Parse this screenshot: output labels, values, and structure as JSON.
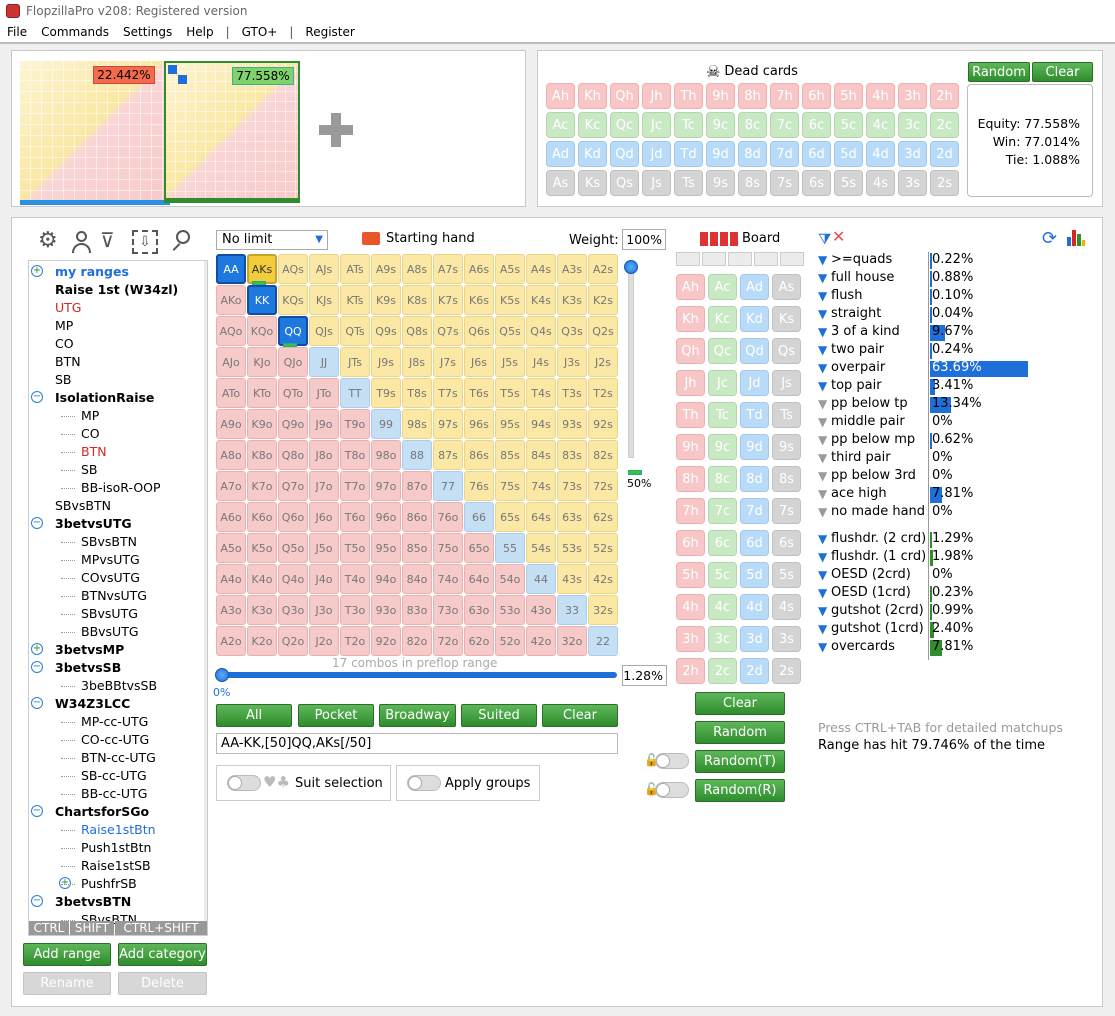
{
  "window": {
    "title": "FlopzillaPro v208: Registered version"
  },
  "menu": [
    "File",
    "Commands",
    "Settings",
    "Help",
    "GTO+",
    "Register"
  ],
  "ranges": {
    "left_pct": "22.442%",
    "right_pct": "77.558%"
  },
  "dead_cards": {
    "title": "Dead cards",
    "random": "Random",
    "clear": "Clear",
    "rows": [
      [
        "Ah",
        "Kh",
        "Qh",
        "Jh",
        "Th",
        "9h",
        "8h",
        "7h",
        "6h",
        "5h",
        "4h",
        "3h",
        "2h"
      ],
      [
        "Ac",
        "Kc",
        "Qc",
        "Jc",
        "Tc",
        "9c",
        "8c",
        "7c",
        "6c",
        "5c",
        "4c",
        "3c",
        "2c"
      ],
      [
        "Ad",
        "Kd",
        "Qd",
        "Jd",
        "Td",
        "9d",
        "8d",
        "7d",
        "6d",
        "5d",
        "4d",
        "3d",
        "2d"
      ],
      [
        "As",
        "Ks",
        "Qs",
        "Js",
        "Ts",
        "9s",
        "8s",
        "7s",
        "6s",
        "5s",
        "4s",
        "3s",
        "2s"
      ]
    ]
  },
  "equity": {
    "equity": "Equity: 77.558%",
    "win": "Win: 77.014%",
    "tie": "Tie: 1.088%"
  },
  "tree": [
    {
      "label": "my ranges",
      "level": 1,
      "style": "blue-bold",
      "toggle": "plus"
    },
    {
      "label": "Raise 1st (W34zl)",
      "level": 1,
      "style": "bold"
    },
    {
      "label": "UTG",
      "level": 1,
      "style": "red"
    },
    {
      "label": "MP",
      "level": 1
    },
    {
      "label": "CO",
      "level": 1
    },
    {
      "label": "BTN",
      "level": 1
    },
    {
      "label": "SB",
      "level": 1
    },
    {
      "label": "IsolationRaise",
      "level": 1,
      "style": "bold",
      "toggle": "minus"
    },
    {
      "label": "MP",
      "level": 2
    },
    {
      "label": "CO",
      "level": 2
    },
    {
      "label": "BTN",
      "level": 2,
      "style": "red"
    },
    {
      "label": "SB",
      "level": 2
    },
    {
      "label": "BB-isoR-OOP",
      "level": 2
    },
    {
      "label": "SBvsBTN",
      "level": 1
    },
    {
      "label": "3betvsUTG",
      "level": 1,
      "style": "bold",
      "toggle": "minus"
    },
    {
      "label": "SBvsBTN",
      "level": 2
    },
    {
      "label": "MPvsUTG",
      "level": 2
    },
    {
      "label": "COvsUTG",
      "level": 2
    },
    {
      "label": "BTNvsUTG",
      "level": 2
    },
    {
      "label": "SBvsUTG",
      "level": 2
    },
    {
      "label": "BBvsUTG",
      "level": 2
    },
    {
      "label": "3betvsMP",
      "level": 1,
      "style": "bold",
      "toggle": "plus"
    },
    {
      "label": "3betvsSB",
      "level": 1,
      "style": "bold",
      "toggle": "minus"
    },
    {
      "label": "3beBBtvsSB",
      "level": 2
    },
    {
      "label": "W34Z3LCC",
      "level": 1,
      "style": "bold",
      "toggle": "minus"
    },
    {
      "label": "MP-cc-UTG",
      "level": 2
    },
    {
      "label": "CO-cc-UTG",
      "level": 2
    },
    {
      "label": "BTN-cc-UTG",
      "level": 2
    },
    {
      "label": "SB-cc-UTG",
      "level": 2
    },
    {
      "label": "BB-cc-UTG",
      "level": 2
    },
    {
      "label": "ChartsforSGo",
      "level": 1,
      "style": "bold",
      "toggle": "minus"
    },
    {
      "label": "Raise1stBtn",
      "level": 2,
      "style": "blue"
    },
    {
      "label": "Push1stBtn",
      "level": 2
    },
    {
      "label": "Raise1stSB",
      "level": 2
    },
    {
      "label": "PushfrSB",
      "level": 2,
      "toggle": "plus"
    },
    {
      "label": "3betvsBTN",
      "level": 1,
      "style": "bold",
      "toggle": "minus"
    },
    {
      "label": "SBvsBTN",
      "level": 2
    }
  ],
  "keys": [
    "CTRL",
    "SHIFT",
    "CTRL+SHIFT"
  ],
  "tree_buttons": {
    "add_range": "Add range",
    "add_category": "Add category",
    "rename": "Rename",
    "delete": "Delete"
  },
  "matrix": {
    "limit": "No limit",
    "starting_hand": "Starting hand",
    "weight_label": "Weight:",
    "weight": "100%",
    "slider_pct": "50%",
    "combos": "17 combos in preflop range",
    "range_pct": "1.28%",
    "zero": "0%",
    "range_text": "AA-KK,[50]QQ,AKs[/50]",
    "ranks": [
      "A",
      "K",
      "Q",
      "J",
      "T",
      "9",
      "8",
      "7",
      "6",
      "5",
      "4",
      "3",
      "2"
    ],
    "buttons": [
      "All",
      "Pocket",
      "Broadway",
      "Suited",
      "Clear"
    ],
    "suit_selection": "Suit selection",
    "apply_groups": "Apply groups"
  },
  "board": {
    "title": "Board",
    "clear": "Clear",
    "random": "Random",
    "random_t": "Random(T)",
    "random_r": "Random(R)",
    "rows": [
      [
        "Ah",
        "Ac",
        "Ad",
        "As"
      ],
      [
        "Kh",
        "Kc",
        "Kd",
        "Ks"
      ],
      [
        "Qh",
        "Qc",
        "Qd",
        "Qs"
      ],
      [
        "Jh",
        "Jc",
        "Jd",
        "Js"
      ],
      [
        "Th",
        "Tc",
        "Td",
        "Ts"
      ],
      [
        "9h",
        "9c",
        "9d",
        "9s"
      ],
      [
        "8h",
        "8c",
        "8d",
        "8s"
      ],
      [
        "7h",
        "7c",
        "7d",
        "7s"
      ],
      [
        "6h",
        "6c",
        "6d",
        "6s"
      ],
      [
        "5h",
        "5c",
        "5d",
        "5s"
      ],
      [
        "4h",
        "4c",
        "4d",
        "4s"
      ],
      [
        "3h",
        "3c",
        "3d",
        "3s"
      ],
      [
        "2h",
        "2c",
        "2d",
        "2s"
      ]
    ]
  },
  "stats": {
    "made": [
      {
        "label": ">=quads",
        "value": "0.22%",
        "pct": 0.22,
        "active": true
      },
      {
        "label": "full house",
        "value": "0.88%",
        "pct": 0.88,
        "active": true
      },
      {
        "label": "flush",
        "value": "0.10%",
        "pct": 0.1,
        "active": true
      },
      {
        "label": "straight",
        "value": "0.04%",
        "pct": 0.04,
        "active": true
      },
      {
        "label": "3 of a kind",
        "value": "9.67%",
        "pct": 9.67,
        "active": true
      },
      {
        "label": "two pair",
        "value": "0.24%",
        "pct": 0.24,
        "active": true
      },
      {
        "label": "overpair",
        "value": "63.69%",
        "pct": 63.69,
        "active": true
      },
      {
        "label": "top pair",
        "value": "3.41%",
        "pct": 3.41,
        "active": true
      },
      {
        "label": "pp below tp",
        "value": "13.34%",
        "pct": 13.34,
        "active": false
      },
      {
        "label": "middle pair",
        "value": "0%",
        "pct": 0,
        "active": false
      },
      {
        "label": "pp below mp",
        "value": "0.62%",
        "pct": 0.62,
        "active": false
      },
      {
        "label": "third pair",
        "value": "0%",
        "pct": 0,
        "active": false
      },
      {
        "label": "pp below 3rd",
        "value": "0%",
        "pct": 0,
        "active": false
      },
      {
        "label": "ace high",
        "value": "7.81%",
        "pct": 7.81,
        "active": false
      },
      {
        "label": "no made hand",
        "value": "0%",
        "pct": 0,
        "active": false
      }
    ],
    "draws": [
      {
        "label": "flushdr. (2 crd)",
        "value": "1.29%",
        "pct": 1.29
      },
      {
        "label": "flushdr. (1 crd)",
        "value": "1.98%",
        "pct": 1.98
      },
      {
        "label": "OESD (2crd)",
        "value": "0%",
        "pct": 0
      },
      {
        "label": "OESD (1crd)",
        "value": "0.23%",
        "pct": 0.23
      },
      {
        "label": "gutshot (2crd)",
        "value": "0.99%",
        "pct": 0.99
      },
      {
        "label": "gutshot (1crd)",
        "value": "2.40%",
        "pct": 2.4
      },
      {
        "label": "overcards",
        "value": "7.81%",
        "pct": 7.81
      }
    ],
    "hint": "Press CTRL+TAB for detailed matchups",
    "hit": "Range has hit 79.746% of the time"
  },
  "colors": {
    "green": "#2f8d2c",
    "blue": "#1e6fd9",
    "red": "#d8261f"
  }
}
